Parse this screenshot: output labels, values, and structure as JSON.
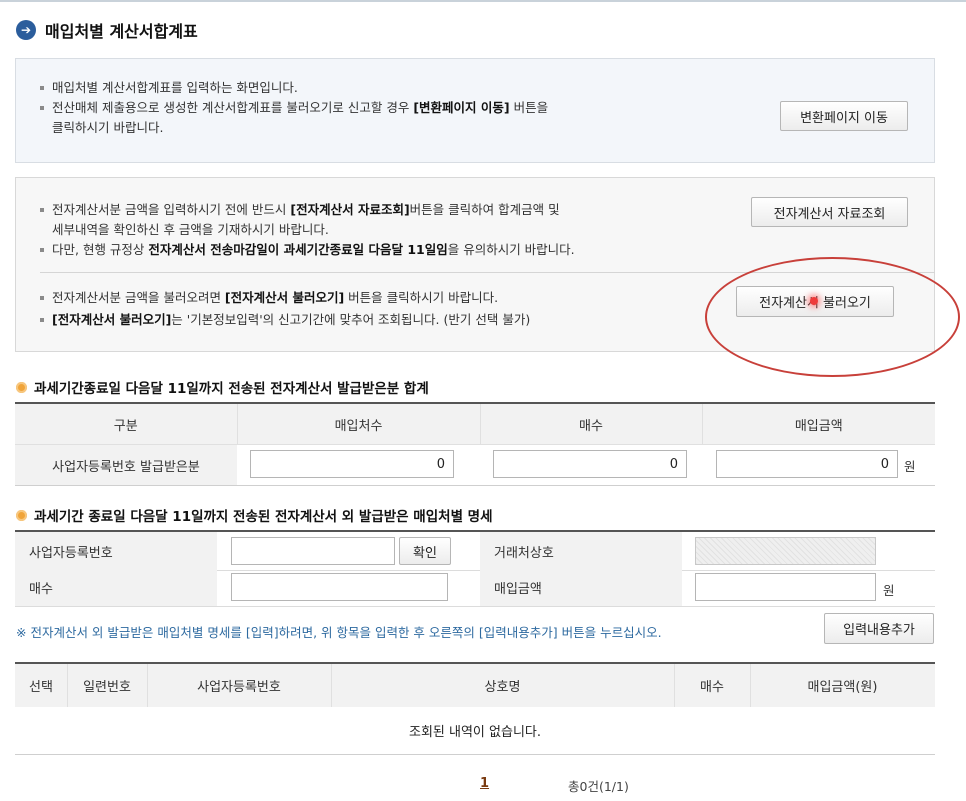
{
  "page": {
    "title": "매입처별 계산서합계표"
  },
  "info_box": {
    "line1": "매입처별 계산서합계표를 입력하는 화면입니다.",
    "line2_a": "전산매체 제출용으로 생성한 계산서합계표를 불러오기로 신고할 경우 ",
    "line2_b": "[변환페이지 이동]",
    "line2_c": " 버튼을",
    "line3": "클릭하시기 바랍니다.",
    "convert_button": "변환페이지 이동"
  },
  "etax_box": {
    "line1_a": "전자계산서분 금액을 입력하시기 전에 반드시 ",
    "line1_b": "[전자계산서 자료조회]",
    "line1_c": "버튼을 클릭하여 합계금액 및",
    "line2": "세부내역을 확인하신 후 금액을 기재하시기 바랍니다.",
    "line3_a": "다만, 현행 규정상 ",
    "line3_b": "전자계산서 전송마감일이 과세기간종료일 다음달 11일임",
    "line3_c": "을 유의하시기 바랍니다.",
    "line4_a": "전자계산서분 금액을 불러오려면 ",
    "line4_b": "[전자계산서 불러오기]",
    "line4_c": " 버튼을 클릭하시기 바랍니다.",
    "line5_a": "[전자계산서 불러오기]",
    "line5_b": "는 '기본정보입력'의 신고기간에 맞추어 조회됩니다. (반기 선택 불가)",
    "lookup_button": "전자계산서 자료조회",
    "load_button": "전자계산서 불러오기"
  },
  "section1": {
    "title": "과세기간종료일 다음달 11일까지 전송된 전자계산서 발급받은분 합계",
    "headers": [
      "구분",
      "매입처수",
      "매수",
      "매입금액"
    ],
    "row_label": "사업자등록번호 발급받은분",
    "values": [
      "0",
      "0",
      "0"
    ],
    "unit": "원"
  },
  "section2": {
    "title": "과세기간 종료일 다음달 11일까지 전송된 전자계산서 외 발급받은 매입처별 명세",
    "biz_no_label": "사업자등록번호",
    "confirm_button": "확인",
    "trade_name_label": "거래처상호",
    "count_label": "매수",
    "amount_label": "매입금액",
    "unit": "원",
    "notice": "※ 전자계산서 외 발급받은 매입처별 명세를 [입력]하려면, 위 항목을 입력한 후 오른쪽의 [입력내용추가] 버튼을 누르십시오.",
    "add_button": "입력내용추가"
  },
  "list_table": {
    "headers": [
      "선택",
      "일련번호",
      "사업자등록번호",
      "상호명",
      "매수",
      "매입금액(원)"
    ],
    "empty_message": "조회된 내역이 없습니다."
  },
  "pagination": {
    "current_page": "1",
    "total": "총0건(1/1)"
  },
  "colors": {
    "accent_blue": "#2b5d9c",
    "section_icon": "#f0a43a",
    "annotation_red": "#c8403a",
    "notice_blue": "#2e6aa0"
  },
  "icons": {
    "title": "arrow-circle-icon",
    "section": "orange-dot-icon"
  }
}
